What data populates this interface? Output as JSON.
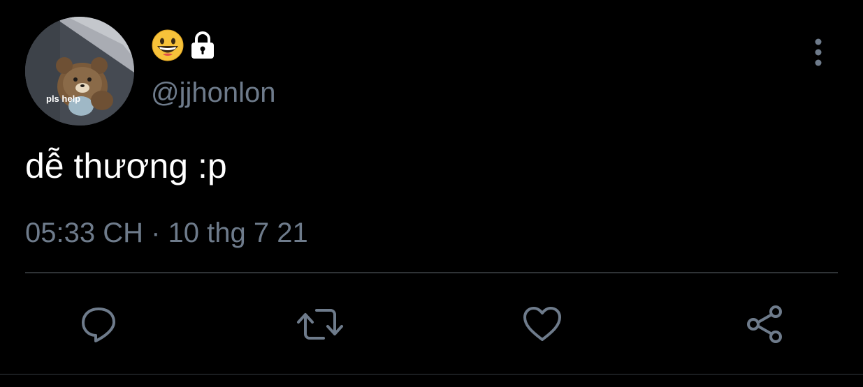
{
  "profile": {
    "avatar_caption": "pls help",
    "display_name_icons": [
      "grinning-face-emoji",
      "lock-icon"
    ],
    "handle": "@jjhonlon"
  },
  "tweet": {
    "text": "dễ thương :p",
    "timestamp": "05:33 CH · 10 thg 7 21"
  },
  "actions": [
    "reply-icon",
    "retweet-icon",
    "like-icon",
    "share-icon"
  ],
  "colors": {
    "background": "#000000",
    "text_primary": "#ffffff",
    "text_secondary": "#6e7b8b",
    "divider": "#2f3336",
    "icon": "#6e7b8b"
  }
}
